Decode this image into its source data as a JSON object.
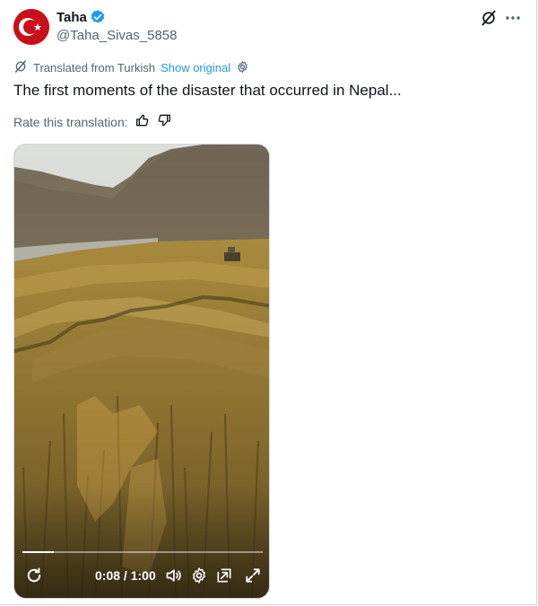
{
  "author": {
    "display_name": "Taha",
    "handle": "@Taha_Sivas_5858",
    "verified": true,
    "avatar_icon": "turkey-flag-avatar"
  },
  "header_actions": {
    "grok_icon": "grok-icon",
    "more_icon": "more-icon"
  },
  "translation": {
    "label": "Translated from Turkish",
    "show_original": "Show original"
  },
  "tweet": {
    "text": "The first moments of the disaster that occurred in Nepal..."
  },
  "rating": {
    "label": "Rate this translation:"
  },
  "video": {
    "current_time": "0:08",
    "separator": " / ",
    "duration": "1:00",
    "progress": 0.13
  },
  "colors": {
    "accent": "#1d9bf0",
    "secondary_text": "#536471",
    "primary_text": "#0f1419"
  }
}
